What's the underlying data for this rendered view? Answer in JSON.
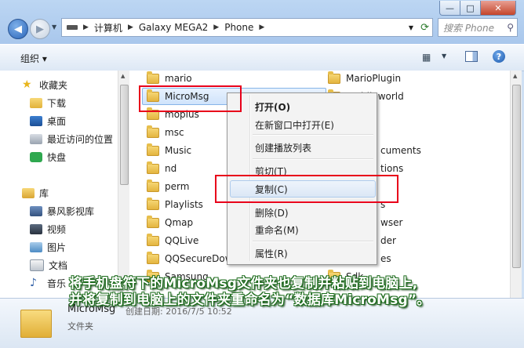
{
  "window": {
    "controls": {
      "minimize": "—",
      "maximize": "□",
      "close": "✕"
    }
  },
  "address": {
    "crumbs": [
      "计算机",
      "Galaxy MEGA2",
      "Phone"
    ],
    "search_placeholder": "搜索 Phone"
  },
  "toolbar": {
    "organize_label": "组织 ▾"
  },
  "nav": {
    "items": [
      {
        "label": "收藏夹",
        "icon": "star-icon"
      },
      {
        "label": "下载",
        "icon": "download-folder-icon"
      },
      {
        "label": "桌面",
        "icon": "desktop-icon"
      },
      {
        "label": "最近访问的位置",
        "icon": "recent-places-icon"
      },
      {
        "label": "快盘",
        "icon": "kuaipan-icon"
      },
      {
        "label": "库",
        "icon": "library-icon"
      },
      {
        "label": "暴风影视库",
        "icon": "video-library-icon"
      },
      {
        "label": "视频",
        "icon": "video-icon"
      },
      {
        "label": "图片",
        "icon": "pictures-icon"
      },
      {
        "label": "文档",
        "icon": "documents-icon"
      },
      {
        "label": "音乐",
        "icon": "music-icon"
      }
    ]
  },
  "files": {
    "left_column": [
      "mario",
      "MicroMsg",
      "moplus",
      "msc",
      "Music",
      "nd",
      "perm",
      "Playlists",
      "Qmap",
      "QQLive",
      "QQSecureDow",
      "Samsung"
    ],
    "right_column": [
      "MarioPlugin",
      "mobileworld",
      "cuments",
      "tions",
      "s",
      "wser",
      "der",
      "es",
      "Sdk"
    ]
  },
  "context_menu": {
    "open": "打开(O)",
    "open_new_window": "在新窗口中打开(E)",
    "create_playlist": "创建播放列表",
    "cut": "剪切(T)",
    "copy": "复制(C)",
    "delete": "删除(D)",
    "rename": "重命名(M)",
    "properties": "属性(R)"
  },
  "details": {
    "name": "MicroMsg",
    "meta": "创建日期: 2016/7/5 10:52",
    "type": "文件夹"
  },
  "overlay": {
    "line1": "将手机盘符下的MicroMsg文件夹也复制并粘贴到电脑上,",
    "line2": "并将复制到电脑上的文件夹重命名为“数据库MicroMsg”。"
  }
}
